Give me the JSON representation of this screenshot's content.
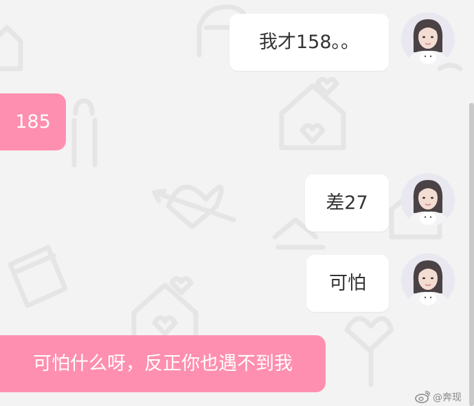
{
  "messages": [
    {
      "direction": "outgoing",
      "text": "我才158。。",
      "avatar": "avatar-icon"
    },
    {
      "direction": "incoming",
      "text": "185"
    },
    {
      "direction": "outgoing",
      "text": "差27",
      "avatar": "avatar-icon"
    },
    {
      "direction": "outgoing",
      "text": "可怕",
      "avatar": "avatar-icon"
    },
    {
      "direction": "incoming",
      "text": "可怕什么呀，反正你也遇不到我"
    }
  ],
  "watermark": {
    "text": "@奔现",
    "icon": "weibo-icon"
  },
  "colors": {
    "background": "#f4f3f3",
    "incoming_bubble": "#ff8fb0",
    "outgoing_bubble": "#ffffff",
    "outgoing_text": "#333333",
    "incoming_text": "#ffffff"
  }
}
